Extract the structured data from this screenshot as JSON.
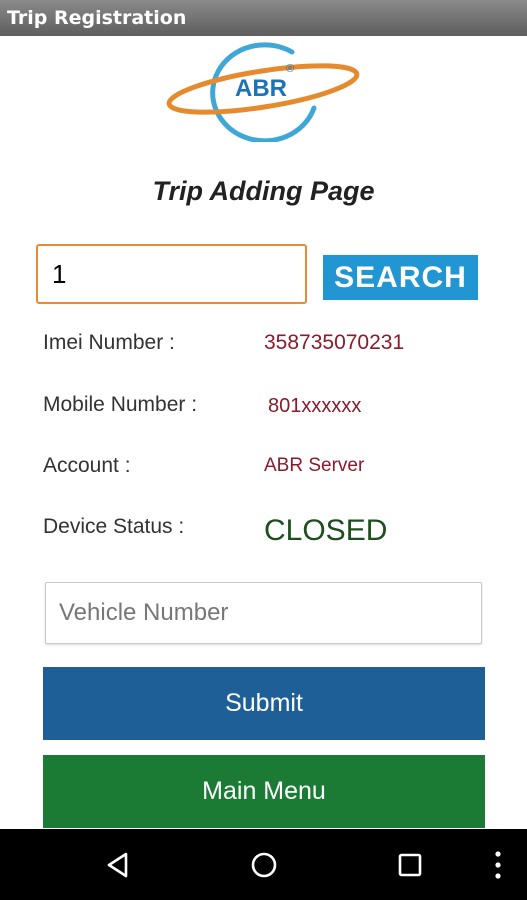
{
  "window": {
    "title": "Trip Registration"
  },
  "logo": {
    "text": "ABR",
    "mark": "®"
  },
  "page": {
    "title": "Trip Adding Page"
  },
  "search": {
    "value": "1",
    "button_label": "SEARCH"
  },
  "info": {
    "imei_label": "Imei Number :",
    "imei_value": "358735070231",
    "mobile_label": "Mobile Number :",
    "mobile_value": "801xxxxxx",
    "account_label": "Account :",
    "account_value": "ABR Server",
    "status_label": "Device Status :",
    "status_value": "CLOSED"
  },
  "vehicle": {
    "placeholder": "Vehicle Number"
  },
  "buttons": {
    "submit_label": "Submit",
    "main_menu_label": "Main Menu"
  },
  "navbar": {
    "icons": [
      "back-icon",
      "home-icon",
      "recents-icon",
      "overflow-menu-icon"
    ]
  },
  "colors": {
    "search_button": "#2196d3",
    "submit_button": "#1f5f98",
    "main_menu_button": "#1b7b35",
    "value_text": "#8b1a2c",
    "status_text": "#1e4d1e",
    "input_focus_border": "#e98a35"
  }
}
